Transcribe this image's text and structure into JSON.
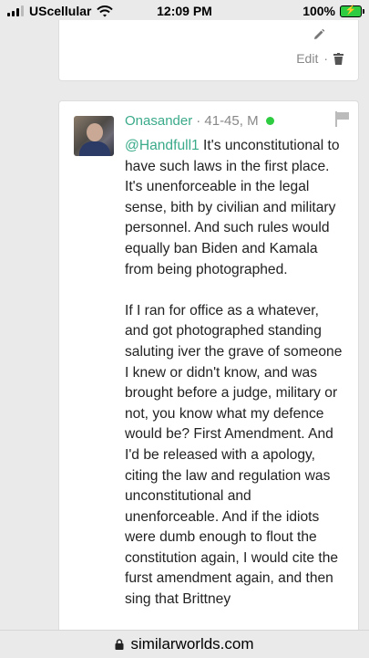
{
  "status_bar": {
    "carrier": "UScellular",
    "time": "12:09 PM",
    "battery_percent": "100%"
  },
  "prev_comment": {
    "edit_label": "Edit",
    "separator": "·"
  },
  "comment": {
    "author": "Onasander",
    "meta": "· 41-45, M",
    "online": true,
    "mention": "@Handfull1",
    "paragraph1_rest": " It's unconstitutional to have such laws in the first place. It's unenforceable in the legal sense, bith by civilian and military personnel. And such rules would equally ban Biden and Kamala from being photographed.",
    "paragraph2": "If I ran for office as a whatever, and got photographed standing saluting iver the grave of someone I knew or didn't know, and was brought before a judge, military or not, you know what my defence would be? First Amendment. And I'd be released with a apology, citing the law and regulation was unconstitutional and unenforceable. And if the idiots were dumb enough to flout the constitution again, I would cite the furst amendment again, and then sing that Brittney"
  },
  "url_bar": {
    "domain": "similarworlds.com"
  },
  "colors": {
    "accent": "#3aaa8a",
    "online": "#2ecc40"
  }
}
